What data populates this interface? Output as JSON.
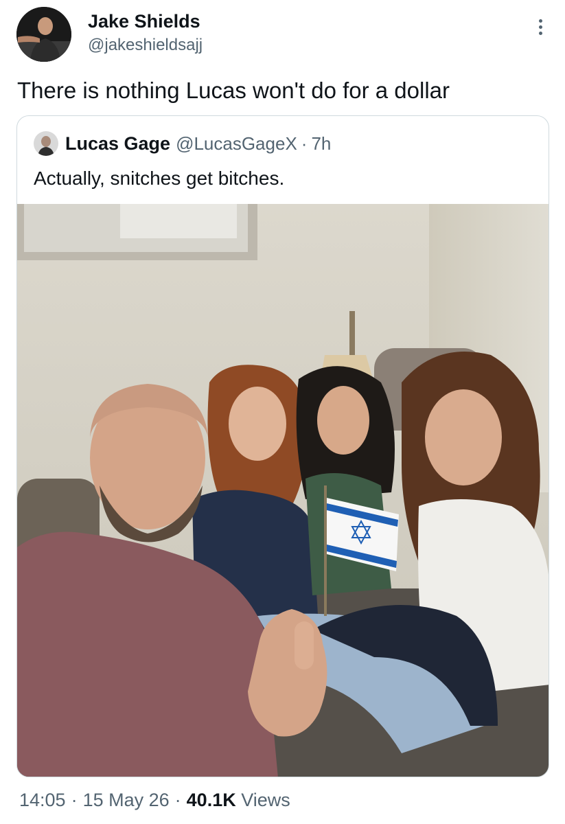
{
  "tweet": {
    "author": {
      "display_name": "Jake Shields",
      "handle": "@jakeshieldsajj",
      "avatar_icon": "author-avatar"
    },
    "text": "There is nothing Lucas won't do for a dollar",
    "more_icon": "more-dots-icon"
  },
  "quoted_tweet": {
    "author": {
      "display_name": "Lucas Gage",
      "handle": "@LucasGageX",
      "avatar_icon": "quoted-author-avatar"
    },
    "separator": "·",
    "time": "7h",
    "text": "Actually, snitches get bitches.",
    "media": "photo"
  },
  "meta": {
    "time": "14:05",
    "separator": "·",
    "date": "15 May 26",
    "views_count": "40.1K",
    "views_label": "Views"
  },
  "colors": {
    "text": "#0f1419",
    "secondary": "#536471",
    "border": "#cfd9de",
    "background": "#ffffff"
  }
}
